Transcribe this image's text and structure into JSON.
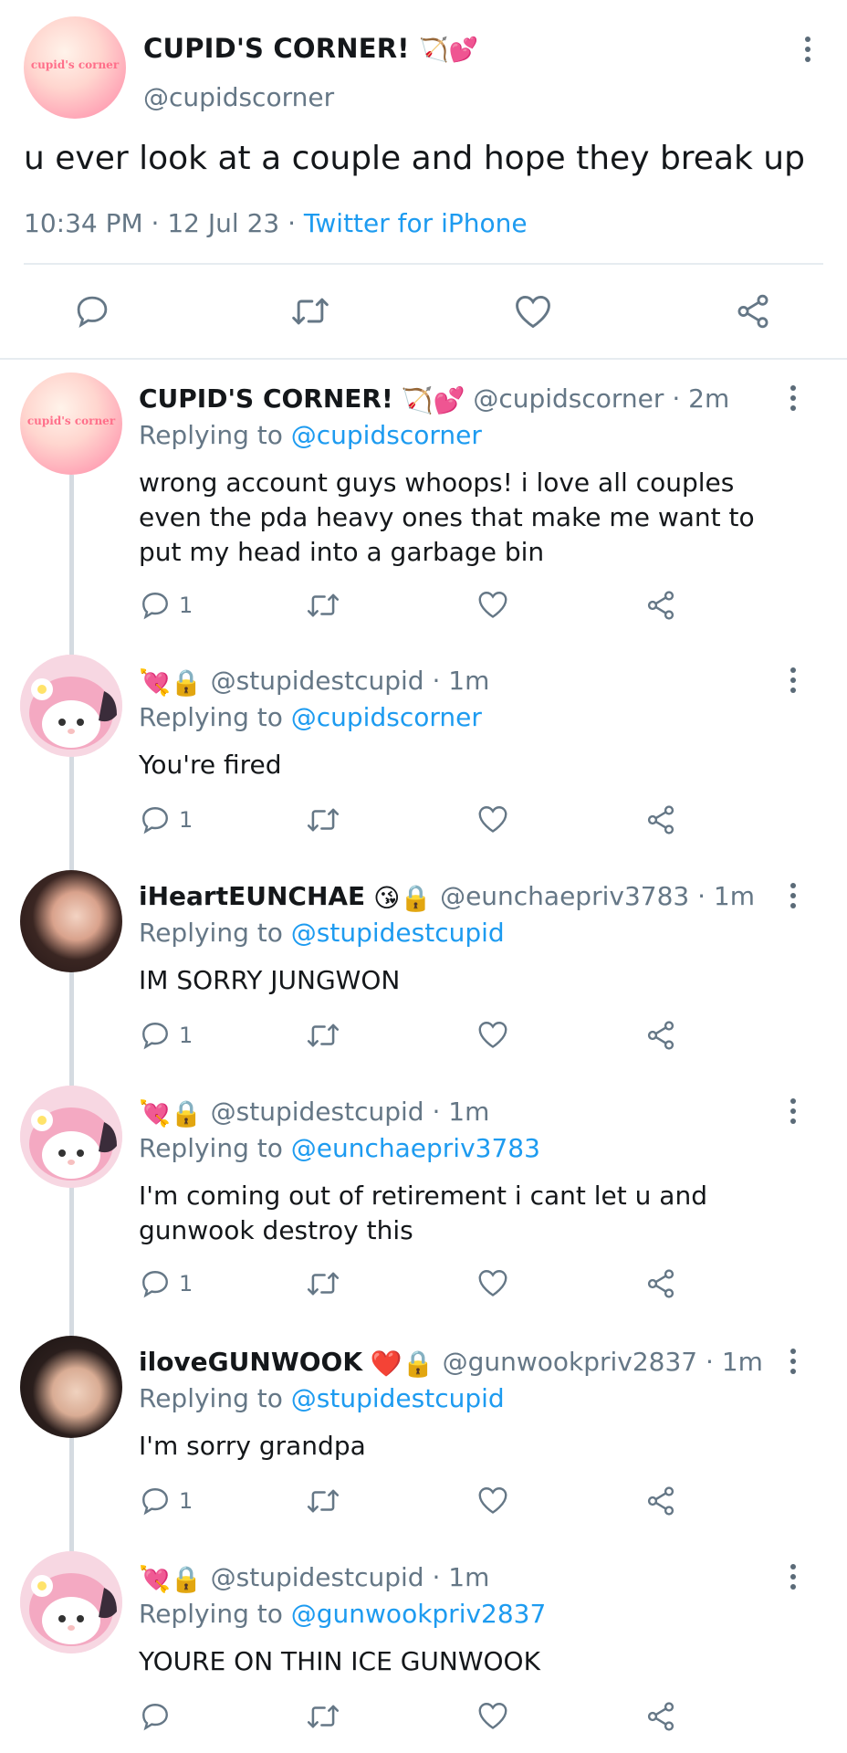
{
  "main_tweet": {
    "avatar_text": "cupid's corner",
    "display_name": "CUPID'S CORNER!",
    "name_emoji": "🏹💕",
    "handle": "@cupidscorner",
    "text": "u ever look at a couple and hope they break up",
    "time": "10:34 PM",
    "date": "12 Jul 23",
    "source": "Twitter for iPhone"
  },
  "replies": [
    {
      "display_name": "CUPID'S CORNER!",
      "name_emoji": "🏹💕",
      "handle": "@cupidscorner",
      "age": "2m",
      "replying_to_label": "Replying to",
      "replying_to": "@cupidscorner",
      "text": "wrong account guys whoops! i love all couples even the pda heavy ones that make me want to put my head into a garbage bin",
      "reply_count": "1"
    },
    {
      "display_name": "",
      "name_emoji": "💘🔒",
      "handle": "@stupidestcupid",
      "age": "1m",
      "replying_to_label": "Replying to",
      "replying_to": "@cupidscorner",
      "text": "You're fired",
      "reply_count": "1"
    },
    {
      "display_name": "iHeartEUNCHAE",
      "name_emoji": "😘🔒",
      "handle": "@eunchaepriv3783",
      "age": "1m",
      "replying_to_label": "Replying to",
      "replying_to": "@stupidestcupid",
      "text": "IM SORRY JUNGWON",
      "reply_count": "1"
    },
    {
      "display_name": "",
      "name_emoji": "💘🔒",
      "handle": "@stupidestcupid",
      "age": "1m",
      "replying_to_label": "Replying to",
      "replying_to": "@eunchaepriv3783",
      "text": "I'm coming out of retirement i cant let u and gunwook destroy this",
      "reply_count": "1"
    },
    {
      "display_name": "iloveGUNWOOK",
      "name_emoji": "❤️🔒",
      "handle": "@gunwookpriv2837",
      "age": "1m",
      "replying_to_label": "Replying to",
      "replying_to": "@stupidestcupid",
      "text": "I'm sorry grandpa",
      "reply_count": "1"
    },
    {
      "display_name": "",
      "name_emoji": "💘🔒",
      "handle": "@stupidestcupid",
      "age": "1m",
      "replying_to_label": "Replying to",
      "replying_to": "@gunwookpriv2837",
      "text": "YOURE ON THIN ICE GUNWOOK",
      "reply_count": ""
    }
  ],
  "icons": {
    "reply": "reply-icon",
    "retweet": "retweet-icon",
    "like": "heart-icon",
    "share": "share-icon",
    "more": "more-options-icon"
  },
  "colors": {
    "link": "#1d9bf0",
    "muted": "#657786",
    "divider": "#e6ecf0"
  }
}
